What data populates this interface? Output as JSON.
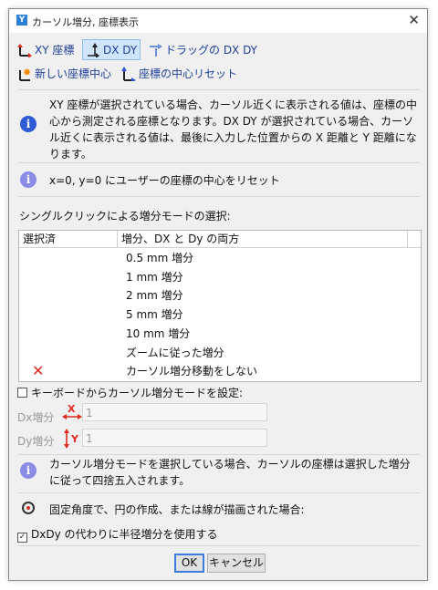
{
  "window": {
    "title": "カーソル増分, 座標表示",
    "close_glyph": "✕",
    "app_glyph": "Y"
  },
  "toolbar": {
    "xy_label": "XY 座標",
    "dxdy_label": "DX DY",
    "drag_label": "ドラッグの DX DY",
    "new_center_label": "新しい座標中心",
    "reset_center_label": "座標の中心リセット"
  },
  "info": {
    "main_text": "XY 座標が選択されている場合、カーソル近くに表示される値は、座標の中心から測定される座標となります。DX DY が選択されている場合、カーソル近くに表示される値は、最後に入力した位置からの X 距離と Y 距離になります。",
    "reset_text": "x=0, y=0 にユーザーの座標の中心をリセット",
    "rounding_text": "カーソル増分モードを選択している場合、カーソルの座標は選択した増分に従って四捨五入されます。"
  },
  "increment": {
    "section_label": "シングルクリックによる増分モードの選択:",
    "col_selected": "選択済",
    "col_increment": "増分、DX と Dy の両方",
    "rows": [
      {
        "label": "0.5 mm 増分",
        "selected": false
      },
      {
        "label": "1 mm 増分",
        "selected": false
      },
      {
        "label": "2 mm 増分",
        "selected": false
      },
      {
        "label": "5 mm 増分",
        "selected": false
      },
      {
        "label": "10 mm 増分",
        "selected": false
      },
      {
        "label": "ズームに従った増分",
        "selected": false
      },
      {
        "label": "カーソル増分移動をしない",
        "selected": true
      }
    ],
    "selected_glyph": "✕"
  },
  "keyboard": {
    "checkbox_label": "キーボードからカーソル増分モードを設定:",
    "checked": false,
    "dx_label": "Dx増分",
    "dx_value": "1",
    "dy_label": "Dy増分",
    "dy_value": "1"
  },
  "angle": {
    "text": "固定角度で、円の作成、または線が描画された場合:",
    "checkbox_label": "DxDy の代わりに半径増分を使用する",
    "checked": true
  },
  "buttons": {
    "ok": "OK",
    "cancel": "キャンセル"
  },
  "colors": {
    "accent": "#2f5bd7",
    "selection": "#cfe5fb",
    "cross": "#e02a20"
  }
}
